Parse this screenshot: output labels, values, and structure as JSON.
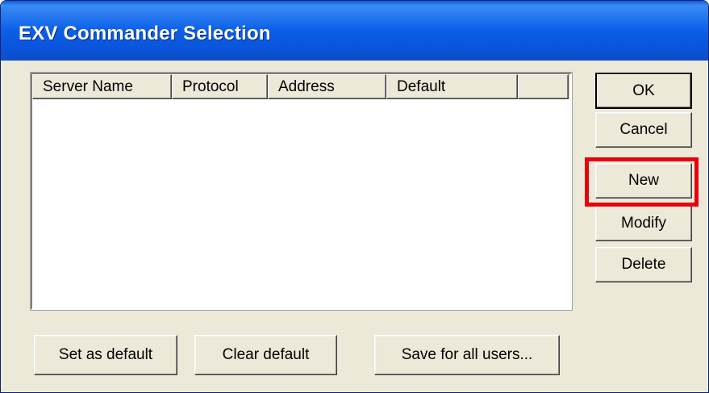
{
  "window": {
    "title": "EXV Commander Selection"
  },
  "server_list": {
    "columns": [
      "Server Name",
      "Protocol",
      "Address",
      "Default",
      ""
    ],
    "rows": []
  },
  "side_buttons": {
    "ok": "OK",
    "cancel": "Cancel",
    "new": "New",
    "modify": "Modify",
    "delete": "Delete"
  },
  "bottom_buttons": {
    "set_default": "Set as default",
    "clear_default": "Clear default",
    "save_all_users": "Save for all users..."
  },
  "highlight": {
    "target": "New",
    "color": "#e8000c"
  }
}
